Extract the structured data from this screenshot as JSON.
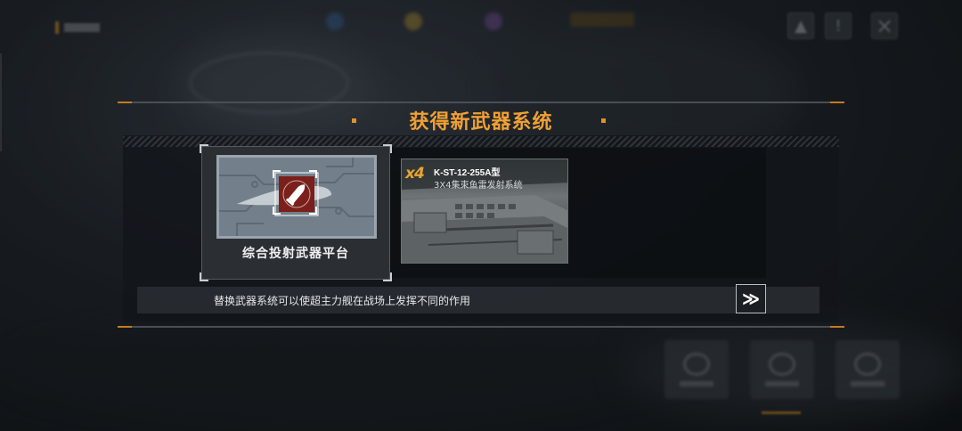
{
  "modal": {
    "title": "获得新武器系统",
    "hint": "替换武器系统可以使超主力舰在战场上发挥不同的作用"
  },
  "rewards": {
    "platform": {
      "label": "综合投射武器平台",
      "icon": "missile-shell-icon"
    },
    "torpedo": {
      "count": "x4",
      "name": "K-ST-12-255A型",
      "description": "3X4集束鱼雷发射系统"
    }
  },
  "colors": {
    "accent": "#f0a035",
    "panel": "#121519",
    "icon_bg": "#7a1f1a"
  }
}
